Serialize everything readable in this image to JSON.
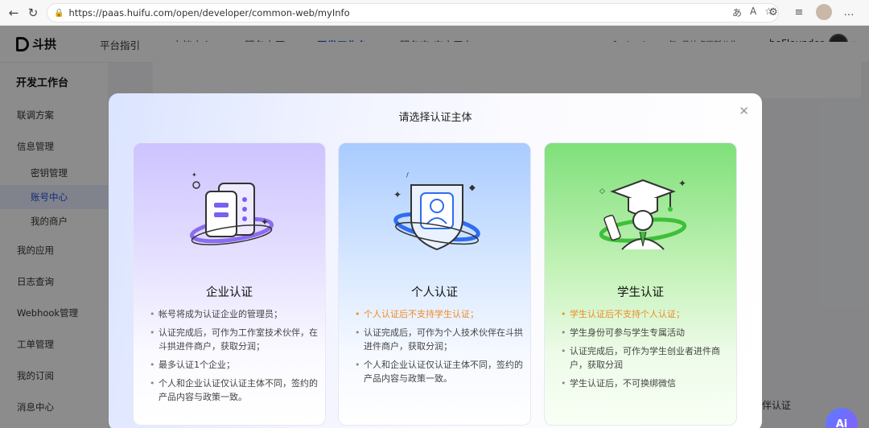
{
  "browser": {
    "url": "https://paas.huifu.com/open/developer/common-web/myInfo",
    "url_domain": "paas.huifu.com",
    "url_path": "/open/developer/common-web/myInfo"
  },
  "app": {
    "logo_text": "斗拱",
    "nav": [
      {
        "label": "平台指引"
      },
      {
        "label": "文档中心"
      },
      {
        "label": "服务大厅"
      },
      {
        "label": "开发工作台"
      },
      {
        "label": "服务商/商户平台"
      }
    ],
    "announcement": "[2.9] 2026年1月站点更新公告",
    "username": "beFlounder"
  },
  "sidebar": {
    "title": "开发工作台",
    "items": [
      {
        "label": "联调方案"
      },
      {
        "label": "信息管理"
      },
      {
        "label": "密钥管理"
      },
      {
        "label": "账号中心"
      },
      {
        "label": "我的商户"
      },
      {
        "label": "我的应用"
      },
      {
        "label": "日志查询"
      },
      {
        "label": "Webhook管理"
      },
      {
        "label": "工单管理"
      },
      {
        "label": "我的订阅"
      },
      {
        "label": "消息中心"
      }
    ]
  },
  "background": {
    "partial_text": "伴认证"
  },
  "modal": {
    "title": "请选择认证主体",
    "cards": [
      {
        "title": "企业认证",
        "items": [
          "帐号将成为认证企业的管理员；",
          "认证完成后，可作为工作室技术伙伴，在斗拱进件商户，获取分润；",
          "最多认证1个企业；",
          "个人和企业认证仅认证主体不同，签约的产品内容与政策一致。"
        ]
      },
      {
        "title": "个人认证",
        "warning": "个人认证后不支持学生认证；",
        "items": [
          "认证完成后，可作为个人技术伙伴在斗拱进件商户，获取分润；",
          "个人和企业认证仅认证主体不同，签约的产品内容与政策一致。"
        ]
      },
      {
        "title": "学生认证",
        "warning": "学生认证后不支持个人认证；",
        "items": [
          "学生身份可参与学生专属活动",
          "认证完成后，可作为学生创业者进件商户，获取分润",
          "学生认证后，不可换绑微信"
        ]
      }
    ]
  },
  "ai_badge": "Ai",
  "colors": {
    "primary": "#1f4fd8",
    "warning": "#f08a24",
    "enterprise": "#cdc3ff",
    "personal": "#a9cbff",
    "student": "#7fe07a"
  }
}
